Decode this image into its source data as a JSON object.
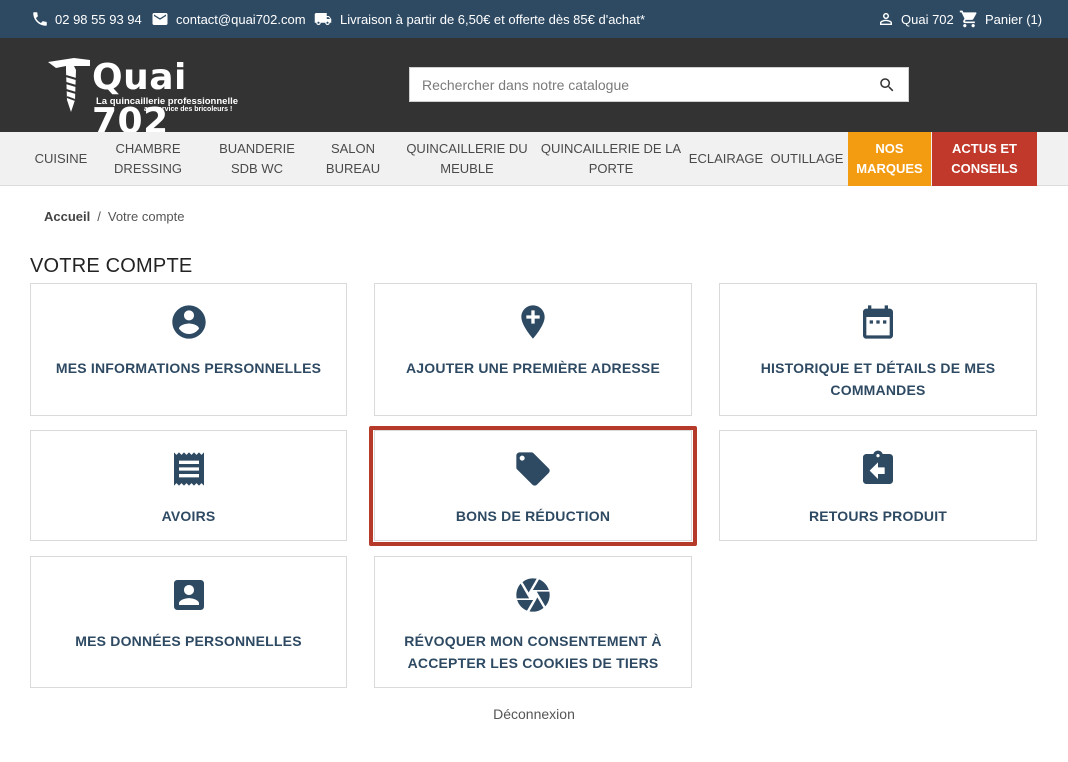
{
  "topbar": {
    "phone": "02 98 55 93 94",
    "email": "contact@quai702.com",
    "shipping": "Livraison à partir de 6,50€ et offerte dès 85€ d'achat*",
    "account": "Quai 702",
    "cart": "Panier (1)",
    "icons": {
      "phone": "phone-icon",
      "email": "email-icon",
      "shipping": "truck-icon",
      "account": "user-icon",
      "cart": "cart-icon"
    }
  },
  "header": {
    "logo_title": "Quai 702",
    "logo_tagline": "La quincaillerie professionnelle",
    "logo_tagline2": "au service des bricoleurs !",
    "search_placeholder": "Rechercher dans notre catalogue"
  },
  "nav": {
    "items": [
      {
        "label": "CUISINE"
      },
      {
        "label": "CHAMBRE DRESSING"
      },
      {
        "label": "BUANDERIE SDB WC"
      },
      {
        "label": "SALON BUREAU"
      },
      {
        "label": "QUINCAILLERIE DU MEUBLE"
      },
      {
        "label": "QUINCAILLERIE DE LA PORTE"
      },
      {
        "label": "ECLAIRAGE"
      },
      {
        "label": "OUTILLAGE"
      },
      {
        "label": "NOS MARQUES"
      },
      {
        "label": "ACTUS ET CONSEILS"
      }
    ],
    "colors": {
      "brands": "#f39c12",
      "news": "#c0392b"
    }
  },
  "breadcrumb": {
    "home": "Accueil",
    "separator": "/",
    "current": "Votre compte"
  },
  "page_title": "VOTRE COMPTE",
  "tiles": [
    {
      "label": "MES INFORMATIONS PERSONNELLES",
      "icon": "account-circle-icon"
    },
    {
      "label": "AJOUTER UNE PREMIÈRE ADRESSE",
      "icon": "add-location-icon"
    },
    {
      "label": "HISTORIQUE ET DÉTAILS DE MES COMMANDES",
      "icon": "calendar-icon"
    },
    {
      "label": "AVOIRS",
      "icon": "receipt-icon"
    },
    {
      "label": "BONS DE RÉDUCTION",
      "icon": "tag-icon"
    },
    {
      "label": "RETOURS PRODUIT",
      "icon": "return-clipboard-icon"
    },
    {
      "label": "MES DONNÉES PERSONNELLES",
      "icon": "account-box-icon"
    },
    {
      "label": "RÉVOQUER MON CONSENTEMENT À ACCEPTER LES COOKIES DE TIERS",
      "icon": "camera-shutter-icon"
    }
  ],
  "highlight_color": "#b53a2a",
  "logout": "Déconnexion"
}
